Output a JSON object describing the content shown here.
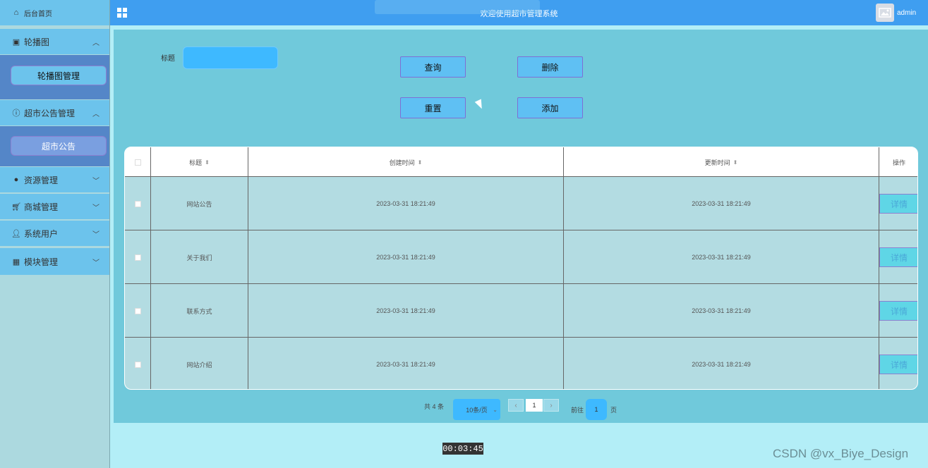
{
  "sidebar": {
    "home": {
      "label": "后台首页",
      "icon": "home-icon"
    },
    "groups": [
      {
        "label": "轮播图",
        "icon": "image-icon",
        "chevron": "^",
        "sub": "轮播图管理"
      },
      {
        "label": "超市公告管理",
        "icon": "info-icon",
        "chevron": "^",
        "sub": "超市公告"
      },
      {
        "label": "资源管理",
        "icon": "location-icon",
        "chevron": "v"
      },
      {
        "label": "商城管理",
        "icon": "cart-icon",
        "chevron": "v"
      },
      {
        "label": "系统用户",
        "icon": "user-icon",
        "chevron": "v"
      },
      {
        "label": "模块管理",
        "icon": "grid-icon",
        "chevron": "v"
      }
    ]
  },
  "header": {
    "title": "欢迎使用超市管理系统",
    "user": "admin"
  },
  "filter": {
    "label": "标题",
    "value": ""
  },
  "buttons": {
    "query": "查询",
    "delete": "删除",
    "reset": "重置",
    "add": "添加"
  },
  "table": {
    "columns": [
      "标题",
      "创建时间",
      "更新时间",
      "操作"
    ],
    "rows": [
      {
        "title": "网站公告",
        "created": "2023-03-31 18:21:49",
        "updated": "2023-03-31 18:21:49",
        "action": "详情"
      },
      {
        "title": "关于我们",
        "created": "2023-03-31 18:21:49",
        "updated": "2023-03-31 18:21:49",
        "action": "详情"
      },
      {
        "title": "联系方式",
        "created": "2023-03-31 18:21:49",
        "updated": "2023-03-31 18:21:49",
        "action": "详情"
      },
      {
        "title": "网站介绍",
        "created": "2023-03-31 18:21:49",
        "updated": "2023-03-31 18:21:49",
        "action": "详情"
      }
    ]
  },
  "pagination": {
    "total": "共 4 条",
    "page_size": "10条/页",
    "current": "1",
    "goto_label": "前往",
    "goto_value": "1",
    "page_suffix": "页"
  },
  "overlay": {
    "timer": "00:03:45",
    "watermark": "CSDN @vx_Biye_Design"
  },
  "colors": {
    "topbar": "#3f9ef0",
    "sidebar_item": "#6cc3ec",
    "submenu": "#5486c8",
    "main_panel": "#70c9db",
    "input": "#3eb9ff"
  }
}
